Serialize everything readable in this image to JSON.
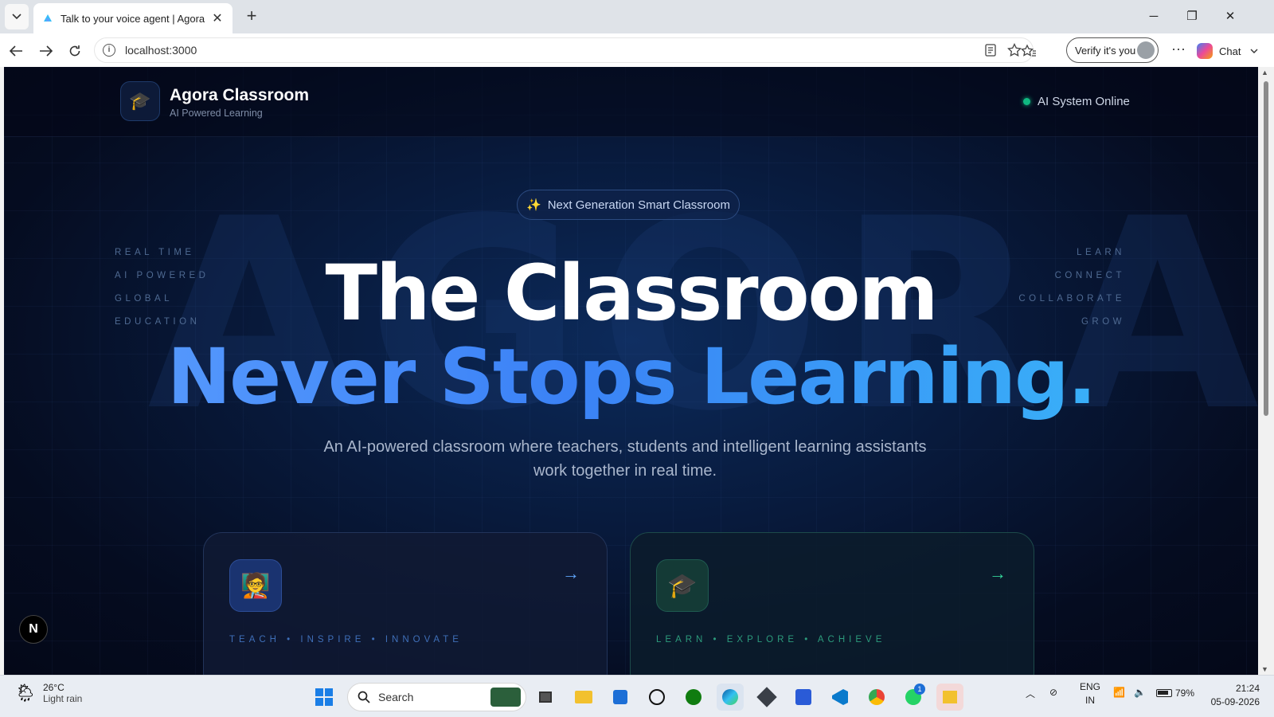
{
  "browser": {
    "tab_title": "Talk to your voice agent | Agora",
    "url": "localhost:3000",
    "verify_label": "Verify it's you",
    "chat_label": "Chat"
  },
  "app": {
    "brand_name": "Agora Classroom",
    "brand_subtitle": "AI Powered Learning",
    "status_text": "AI System Online",
    "background_word": "AGORA",
    "badge_text": "Next Generation Smart Classroom",
    "left_words": [
      "REAL TIME",
      "AI POWERED",
      "GLOBAL",
      "EDUCATION"
    ],
    "right_words": [
      "LEARN",
      "CONNECT",
      "COLLABORATE",
      "GROW"
    ],
    "headline_line1": "The Classroom",
    "headline_line2": "Never Stops Learning.",
    "description": "An AI-powered classroom where teachers, students and intelligent learning assistants work together in real time.",
    "cards": [
      {
        "icon": "teacher-icon",
        "tagline": "TEACH • INSPIRE • INNOVATE",
        "arrow": "→"
      },
      {
        "icon": "graduation-cap-icon",
        "tagline": "LEARN • EXPLORE • ACHIEVE",
        "arrow": "→"
      }
    ],
    "next_badge": "N"
  },
  "taskbar": {
    "temperature": "26°C",
    "weather": "Light rain",
    "search_placeholder": "Search",
    "lang_top": "ENG",
    "lang_bottom": "IN",
    "battery": "79%",
    "time": "21:24",
    "date": "05-09-2026",
    "whatsapp_badge": "1"
  },
  "colors": {
    "accent_blue": "#3b82f6",
    "accent_cyan": "#38bdf8",
    "status_green": "#10b981",
    "page_background": "#050c20"
  }
}
